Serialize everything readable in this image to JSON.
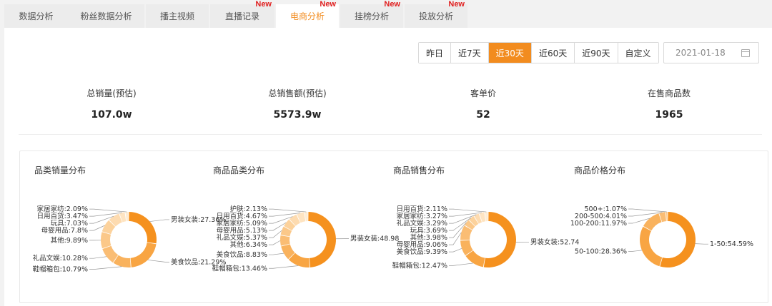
{
  "tabs": [
    {
      "label": "数据分析",
      "new": false,
      "active": false
    },
    {
      "label": "粉丝数据分析",
      "new": false,
      "active": false
    },
    {
      "label": "播主视频",
      "new": false,
      "active": false
    },
    {
      "label": "直播记录",
      "new": true,
      "active": false
    },
    {
      "label": "电商分析",
      "new": true,
      "active": true
    },
    {
      "label": "挂榜分析",
      "new": true,
      "active": false
    },
    {
      "label": "投放分析",
      "new": true,
      "active": false
    }
  ],
  "new_badge": "New",
  "date_range": {
    "options": [
      "昨日",
      "近7天",
      "近30天",
      "近60天",
      "近90天",
      "自定义"
    ],
    "active": "近30天",
    "date": "2021-01-18"
  },
  "stats": [
    {
      "label": "总销量(预估)",
      "value": "107.0w"
    },
    {
      "label": "总销售额(预估)",
      "value": "5573.9w"
    },
    {
      "label": "客单价",
      "value": "52"
    },
    {
      "label": "在售商品数",
      "value": "1965"
    }
  ],
  "colors": {
    "accent": "#f28c1f"
  },
  "chart_data": [
    {
      "type": "pie",
      "title": "品类销量分布",
      "slices": [
        {
          "label": "男装女装:27.36%",
          "value": 27.36
        },
        {
          "label": "美食饮品:21.29%",
          "value": 21.29
        },
        {
          "label": "鞋帽箱包:10.79%",
          "value": 10.79
        },
        {
          "label": "礼品文娱:10.28%",
          "value": 10.28
        },
        {
          "label": "其他:9.89%",
          "value": 9.89
        },
        {
          "label": "母婴用品:7.8%",
          "value": 7.8
        },
        {
          "label": "玩具:7.03%",
          "value": 7.03
        },
        {
          "label": "日用百货:3.47%",
          "value": 3.47
        },
        {
          "label": "家居家纺:2.09%",
          "value": 2.09
        }
      ]
    },
    {
      "type": "pie",
      "title": "商品品类分布",
      "slices": [
        {
          "label": "男装女装:48.98",
          "value": 48.98
        },
        {
          "label": "鞋帽箱包:13.46%",
          "value": 13.46
        },
        {
          "label": "美食饮品:8.83%",
          "value": 8.83
        },
        {
          "label": "其他:6.34%",
          "value": 6.34
        },
        {
          "label": "礼品文娱:5.37%",
          "value": 5.37
        },
        {
          "label": "母婴用品:5.13%",
          "value": 5.13
        },
        {
          "label": "家居家纺:5.09%",
          "value": 5.09
        },
        {
          "label": "日用百货:4.67%",
          "value": 4.67
        },
        {
          "label": "护肤:2.13%",
          "value": 2.13
        }
      ]
    },
    {
      "type": "pie",
      "title": "商品销售分布",
      "slices": [
        {
          "label": "男装女装:52.74",
          "value": 52.74
        },
        {
          "label": "鞋帽箱包:12.47%",
          "value": 12.47
        },
        {
          "label": "美食饮品:9.39%",
          "value": 9.39
        },
        {
          "label": "母婴用品:9.06%",
          "value": 9.06
        },
        {
          "label": "其他:3.98%",
          "value": 3.98
        },
        {
          "label": "玩具:3.69%",
          "value": 3.69
        },
        {
          "label": "礼品文娱:3.29%",
          "value": 3.29
        },
        {
          "label": "家居家纺:3.27%",
          "value": 3.27
        },
        {
          "label": "日用百货:2.11%",
          "value": 2.11
        }
      ]
    },
    {
      "type": "pie",
      "title": "商品价格分布",
      "slices": [
        {
          "label": "1-50:54.59%",
          "value": 54.59
        },
        {
          "label": "50-100:28.36%",
          "value": 28.36
        },
        {
          "label": "100-200:11.97%",
          "value": 11.97
        },
        {
          "label": "200-500:4.01%",
          "value": 4.01
        },
        {
          "label": "500+:1.07%",
          "value": 1.07
        }
      ]
    }
  ]
}
